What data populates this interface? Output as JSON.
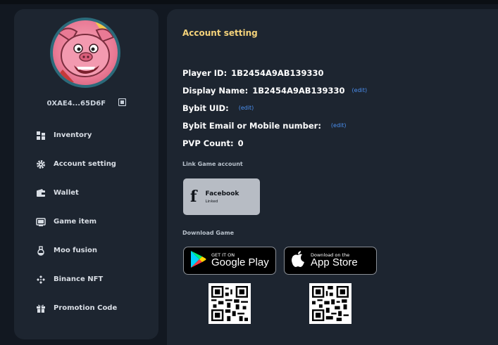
{
  "profile": {
    "wallet_address": "0XAE4...65D6F"
  },
  "menu": {
    "items": [
      {
        "label": "Inventory",
        "icon": "inventory-icon"
      },
      {
        "label": "Account setting",
        "icon": "gear-icon"
      },
      {
        "label": "Wallet",
        "icon": "wallet-icon"
      },
      {
        "label": "Game item",
        "icon": "game-item-icon"
      },
      {
        "label": "Moo fusion",
        "icon": "flask-icon"
      },
      {
        "label": "Binance NFT",
        "icon": "binance-icon"
      },
      {
        "label": "Promotion Code",
        "icon": "gift-icon"
      }
    ]
  },
  "account": {
    "title": "Account setting",
    "player_id_label": "Player ID:",
    "player_id_value": "1B2454A9AB139330",
    "display_name_label": "Display Name:",
    "display_name_value": "1B2454A9AB139330",
    "bybit_uid_label": "Bybit UID:",
    "bybit_contact_label": "Bybit Email or Mobile number:",
    "pvp_label": "PVP Count:",
    "pvp_value": "0",
    "edit_label": "(edit)"
  },
  "link_section": {
    "label": "Link Game account",
    "facebook_name": "Facebook",
    "facebook_status": "Linked"
  },
  "download": {
    "label": "Download Game",
    "google_small": "GET IT ON",
    "google_big": "Google Play",
    "apple_small": "Download on the",
    "apple_big": "App Store"
  },
  "colors": {
    "background": "#121821",
    "panel": "#1d2530",
    "title_accent": "#f4d27a",
    "link": "#4a8ff0"
  }
}
